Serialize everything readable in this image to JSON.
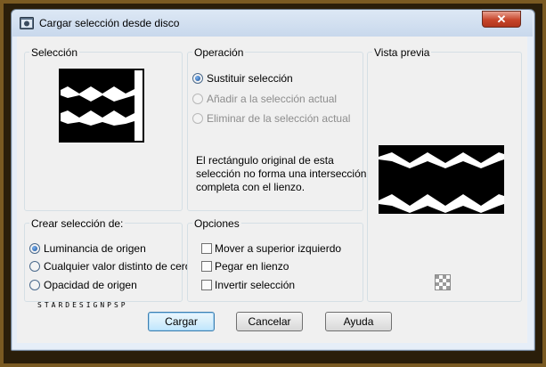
{
  "window": {
    "title": "Cargar selección desde disco"
  },
  "seleccion": {
    "legend": "Selección"
  },
  "operacion": {
    "legend": "Operación",
    "options": [
      {
        "label": "Sustituir selección",
        "checked": true,
        "enabled": true
      },
      {
        "label": "Añadir a la selección actual",
        "checked": false,
        "enabled": false
      },
      {
        "label": "Eliminar de la selección actual",
        "checked": false,
        "enabled": false
      }
    ],
    "message": [
      "El rectángulo original de esta",
      "selección no forma una intersección",
      "completa con el lienzo."
    ]
  },
  "vista_previa": {
    "legend": "Vista previa"
  },
  "crear": {
    "legend": "Crear selección de:",
    "options": [
      {
        "label": "Luminancia de origen",
        "checked": true
      },
      {
        "label": "Cualquier valor distinto de cero",
        "checked": false
      },
      {
        "label": "Opacidad de origen",
        "checked": false
      }
    ]
  },
  "opciones": {
    "legend": "Opciones",
    "checks": [
      {
        "label": "Mover a superior izquierdo",
        "checked": false
      },
      {
        "label": "Pegar en lienzo",
        "checked": false
      },
      {
        "label": "Invertir selección",
        "checked": false
      }
    ]
  },
  "watermark": "STARDESIGNPSP",
  "buttons": {
    "cargar": "Cargar",
    "cancelar": "Cancelar",
    "ayuda": "Ayuda"
  },
  "icons": {
    "app": "app-window-icon",
    "close": "close-icon",
    "transparency": "transparency-checker-icon"
  },
  "colors": {
    "close": "#c7452a",
    "accent": "#3c7fb1"
  }
}
